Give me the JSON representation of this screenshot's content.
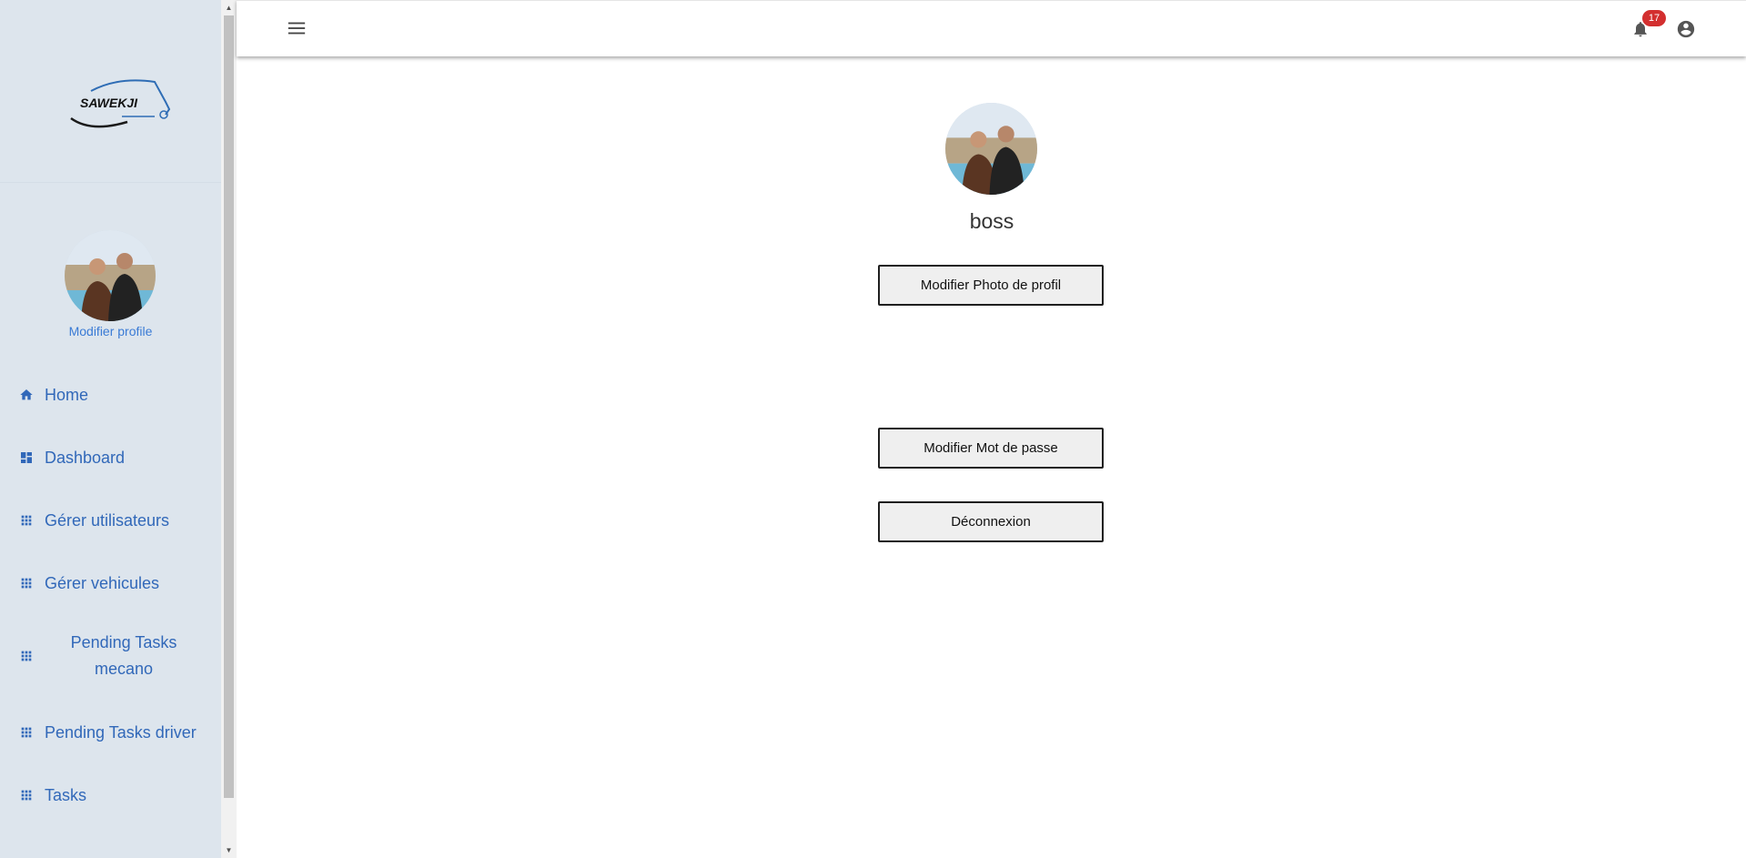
{
  "brand": {
    "logo_text": "SAWEKJI"
  },
  "sidebar": {
    "edit_profile_link": "Modifier profile",
    "items": [
      {
        "label": "Home",
        "icon": "home-icon"
      },
      {
        "label": "Dashboard",
        "icon": "dashboard-icon"
      },
      {
        "label": "Gérer utilisateurs",
        "icon": "apps-grid-icon"
      },
      {
        "label": "Gérer vehicules",
        "icon": "apps-grid-icon"
      },
      {
        "label": "Pending Tasks mecano",
        "icon": "apps-grid-icon"
      },
      {
        "label": "Pending Tasks driver",
        "icon": "apps-grid-icon"
      },
      {
        "label": "Tasks",
        "icon": "apps-grid-icon"
      }
    ]
  },
  "topbar": {
    "notification_count": "17",
    "icons": [
      "menu-icon",
      "bell-icon",
      "account-circle-icon"
    ]
  },
  "profile": {
    "username": "boss",
    "buttons": {
      "change_photo": "Modifier Photo de profil",
      "change_password": "Modifier Mot de passe",
      "logout": "Déconnexion"
    }
  },
  "colors": {
    "sidebar_bg": "#dde5ed",
    "nav_text": "#3168b9",
    "link": "#3a7bd5",
    "badge": "#d32f2f"
  }
}
